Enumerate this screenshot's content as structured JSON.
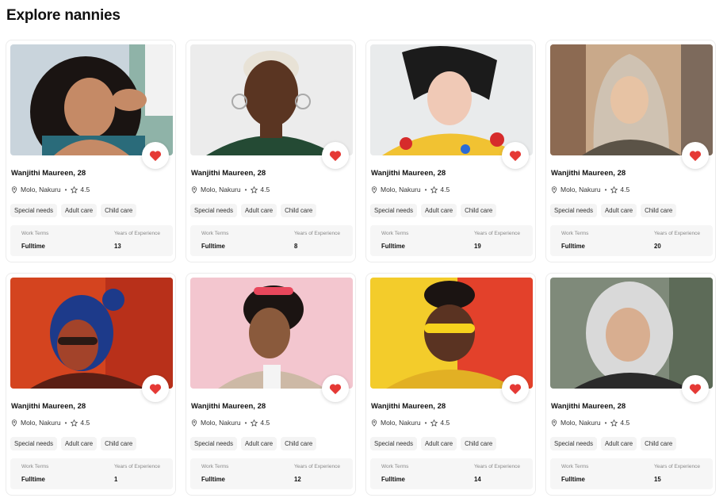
{
  "page": {
    "title": "Explore nannies"
  },
  "colors": {
    "accent": "#e53935",
    "tag_bg": "#f4f4f4",
    "info_bg": "#f6f6f6"
  },
  "icons": {
    "favorite": "heart-icon",
    "location": "location-pin-icon",
    "rating": "star-icon"
  },
  "cards": [
    {
      "name": "Wanjithi Maureen, 28",
      "location": "Molo, Nakuru",
      "rating": "4.5",
      "tags": [
        "Special needs",
        "Adult care",
        "Child care"
      ],
      "work_terms_label": "Work Terms",
      "work_terms": "Fulltime",
      "experience_label": "Years of Experience",
      "experience": "13"
    },
    {
      "name": "Wanjithi Maureen, 28",
      "location": "Molo, Nakuru",
      "rating": "4.5",
      "tags": [
        "Special needs",
        "Adult care",
        "Child care"
      ],
      "work_terms_label": "Work Terms",
      "work_terms": "Fulltime",
      "experience_label": "Years of Experience",
      "experience": "8"
    },
    {
      "name": "Wanjithi Maureen, 28",
      "location": "Molo, Nakuru",
      "rating": "4.5",
      "tags": [
        "Special needs",
        "Adult care",
        "Child care"
      ],
      "work_terms_label": "Work Terms",
      "work_terms": "Fulltime",
      "experience_label": "Years of Experience",
      "experience": "19"
    },
    {
      "name": "Wanjithi Maureen, 28",
      "location": "Molo, Nakuru",
      "rating": "4.5",
      "tags": [
        "Special needs",
        "Adult care",
        "Child care"
      ],
      "work_terms_label": "Work Terms",
      "work_terms": "Fulltime",
      "experience_label": "Years of Experience",
      "experience": "20"
    },
    {
      "name": "Wanjithi Maureen, 28",
      "location": "Molo, Nakuru",
      "rating": "4.5",
      "tags": [
        "Special needs",
        "Adult care",
        "Child care"
      ],
      "work_terms_label": "Work Terms",
      "work_terms": "Fulltime",
      "experience_label": "Years of Experience",
      "experience": "1"
    },
    {
      "name": "Wanjithi Maureen, 28",
      "location": "Molo, Nakuru",
      "rating": "4.5",
      "tags": [
        "Special needs",
        "Adult care",
        "Child care"
      ],
      "work_terms_label": "Work Terms",
      "work_terms": "Fulltime",
      "experience_label": "Years of Experience",
      "experience": "12"
    },
    {
      "name": "Wanjithi Maureen, 28",
      "location": "Molo, Nakuru",
      "rating": "4.5",
      "tags": [
        "Special needs",
        "Adult care",
        "Child care"
      ],
      "work_terms_label": "Work Terms",
      "work_terms": "Fulltime",
      "experience_label": "Years of Experience",
      "experience": "14"
    },
    {
      "name": "Wanjithi Maureen, 28",
      "location": "Molo, Nakuru",
      "rating": "4.5",
      "tags": [
        "Special needs",
        "Adult care",
        "Child care"
      ],
      "work_terms_label": "Work Terms",
      "work_terms": "Fulltime",
      "experience_label": "Years of Experience",
      "experience": "15"
    }
  ]
}
